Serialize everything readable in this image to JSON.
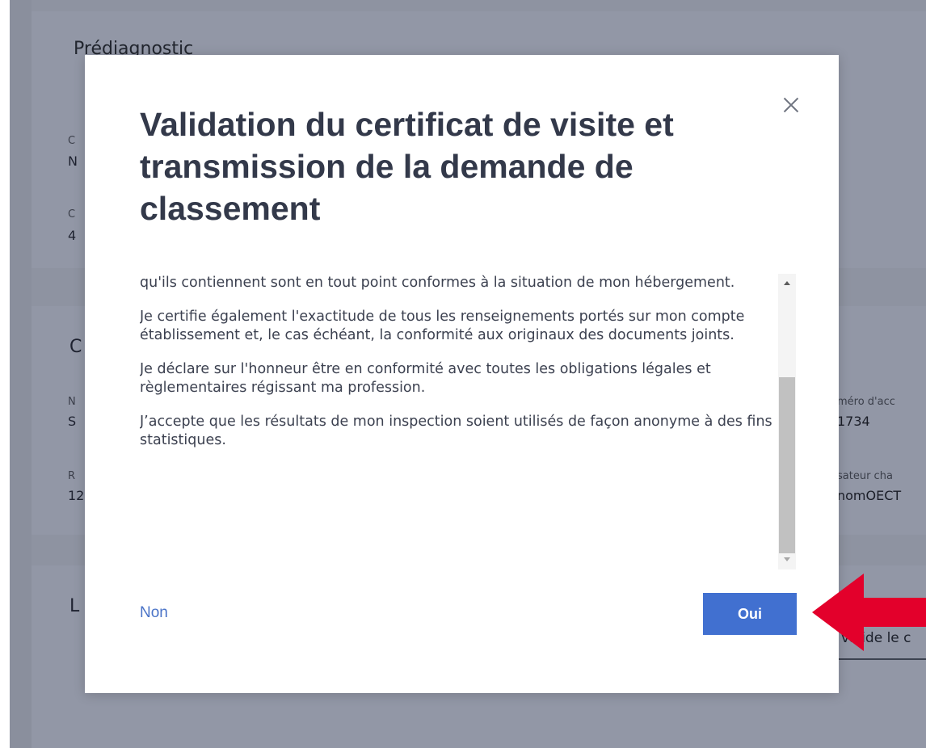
{
  "background": {
    "section_title": "Prédiagnostic",
    "row_letters_1": [
      "C",
      "N",
      "C",
      "4"
    ],
    "row_letters_2": [
      "C",
      "N",
      "S",
      "R",
      "12"
    ],
    "row_letters_3": [
      "L"
    ],
    "right_label_1": "méro d'acc",
    "right_value_1": "1734",
    "right_label_2": "sateur cha",
    "right_value_2": "nomOECT",
    "right_button": "valide le c"
  },
  "modal": {
    "title": "Validation du certificat de visite et transmission de la demande de classement",
    "paragraphs": [
      "qu'ils contiennent sont en tout point conformes à la situation de mon hébergement.",
      "Je certifie également l'exactitude de tous les renseignements portés sur mon compte établissement et, le cas échéant, la conformité aux originaux des documents joints.",
      "Je déclare sur l'honneur être en conformité avec toutes les obligations légales et règlementaires régissant ma profession.",
      "J’accepte que les résultats de mon inspection soient utilisés de façon anonyme à des fins statistiques."
    ],
    "cancel_label": "Non",
    "confirm_label": "Oui",
    "confirm_color": "#4170d0",
    "link_color": "#4a73c7"
  },
  "annotation": {
    "arrow_color": "#e3002b",
    "arrow_icon": "red-left-arrow-icon"
  }
}
